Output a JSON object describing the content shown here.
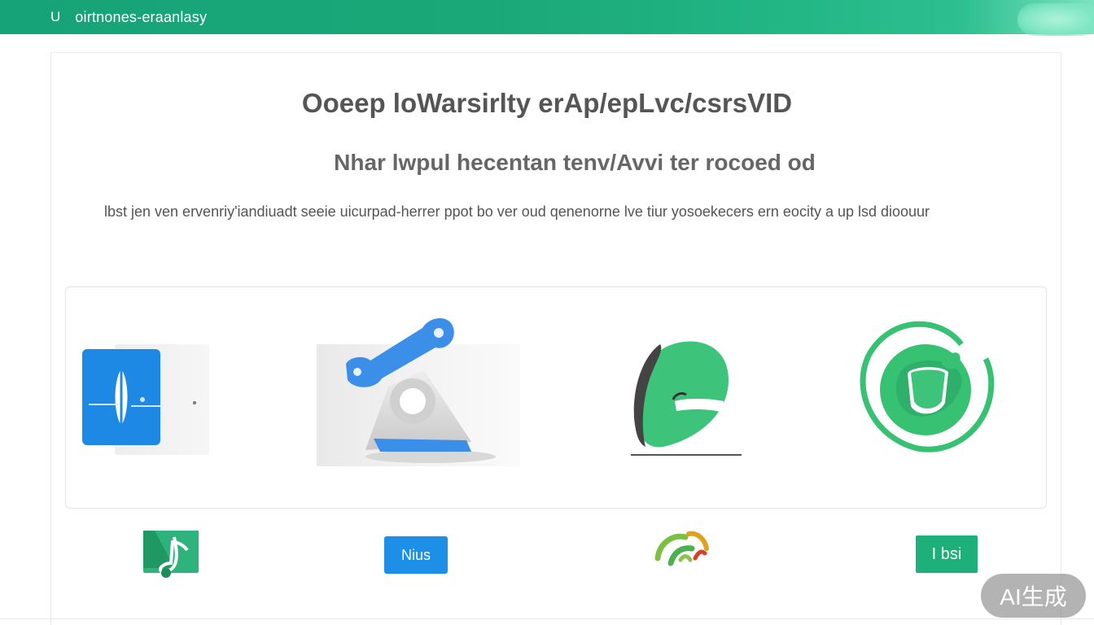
{
  "header": {
    "brand_mark": "U",
    "brand_text": "oirtnones-eraanlasy",
    "color": "#1aa878"
  },
  "hero": {
    "title": "Ooeep loWarsirlty erAp/epLvc/csrsVID",
    "subtitle": "Nhar lwpul hecentan tenv/Avvi  ter rocoed od",
    "description": "lbst jen ven ervenriy'iandiuadt seeie uicurpad-herrer ppot bo ver oud qenenorne lve tiur yosoekecers ern eocity a up lsd dioouur"
  },
  "features": [
    {
      "icon": "document-icon",
      "color": "#1e88e5"
    },
    {
      "icon": "mount-arm-icon",
      "color": "#3b8fe8"
    },
    {
      "icon": "chat-bubble-icon",
      "color": "#3ec47a"
    },
    {
      "icon": "ring-icon",
      "color": "#37c273"
    }
  ],
  "badges": [
    {
      "icon": "music-note-icon",
      "color": "#2fb37d"
    },
    {
      "label": "Nius",
      "color": "#1e8fe6"
    },
    {
      "icon": "swirl-icon",
      "color": "#7bc043"
    },
    {
      "label": "I bsi",
      "color": "#1db07a"
    }
  ],
  "watermark": {
    "label": "AI生成"
  }
}
